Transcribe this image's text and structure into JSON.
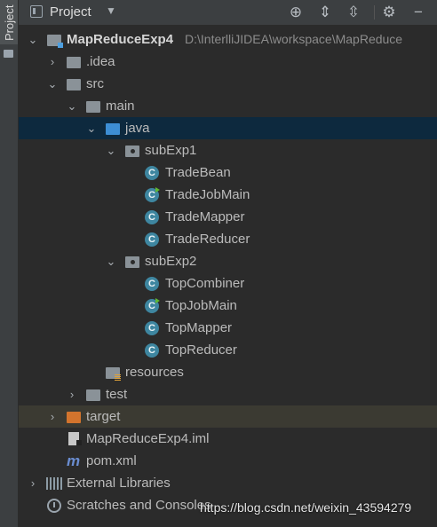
{
  "sidebar": {
    "project_tab": "Project"
  },
  "toolbar": {
    "title": "Project",
    "dropdown_icon": "caret-down-icon",
    "actions": [
      "locate-icon",
      "expand-all-icon",
      "collapse-all-icon",
      "gear-icon",
      "minimize-icon"
    ]
  },
  "tree": {
    "root": {
      "name": "MapReduceExp4",
      "path": "D:\\InterlliJIDEA\\workspace\\MapReduce"
    },
    "idea": ".idea",
    "src": "src",
    "main": "main",
    "java": "java",
    "pkg1": {
      "name": "subExp1",
      "classes": [
        "TradeBean",
        "TradeJobMain",
        "TradeMapper",
        "TradeReducer"
      ]
    },
    "pkg2": {
      "name": "subExp2",
      "classes": [
        "TopCombiner",
        "TopJobMain",
        "TopMapper",
        "TopReducer"
      ]
    },
    "resources": "resources",
    "test": "test",
    "target": "target",
    "iml": "MapReduceExp4.iml",
    "pom": "pom.xml",
    "external_libraries": "External Libraries",
    "scratches": "Scratches and Consoles"
  },
  "class_icon_letter": "C",
  "maven_icon_letter": "m",
  "watermark": "https://blog.csdn.net/weixin_43594279",
  "colors": {
    "selection": "#0d293e",
    "excluded_row": "#3b3a32",
    "class_icon": "#3e86a0",
    "source_folder": "#3d8ed4",
    "excluded_folder": "#d3742d"
  }
}
